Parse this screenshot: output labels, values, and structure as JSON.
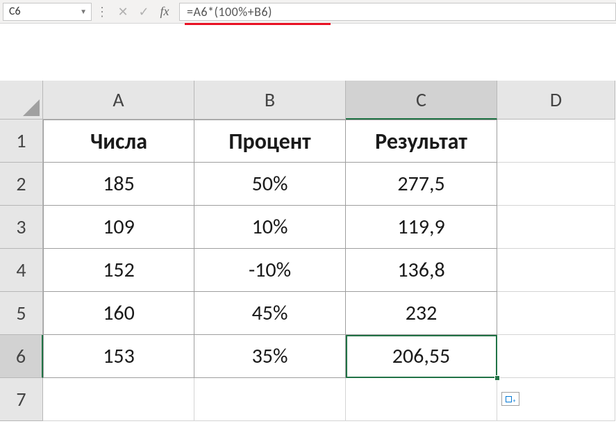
{
  "formula_bar": {
    "cell_ref": "C6",
    "formula": "=A6*(100%+B6)"
  },
  "columns": [
    "A",
    "B",
    "C",
    "D"
  ],
  "rows": [
    "1",
    "2",
    "3",
    "4",
    "5",
    "6",
    "7"
  ],
  "headers": {
    "A": "Числа",
    "B": "Процент",
    "C": "Результат"
  },
  "data": {
    "r2": {
      "A": "185",
      "B": "50%",
      "C": "277,5"
    },
    "r3": {
      "A": "109",
      "B": "10%",
      "C": "119,9"
    },
    "r4": {
      "A": "152",
      "B": "-10%",
      "C": "136,8"
    },
    "r5": {
      "A": "160",
      "B": "45%",
      "C": "232"
    },
    "r6": {
      "A": "153",
      "B": "35%",
      "C": "206,55"
    }
  },
  "active_cell": "C6",
  "chart_data": {
    "type": "table",
    "columns": [
      "Числа",
      "Процент",
      "Результат"
    ],
    "rows": [
      [
        185,
        "50%",
        "277,5"
      ],
      [
        109,
        "10%",
        "119,9"
      ],
      [
        152,
        "-10%",
        "136,8"
      ],
      [
        160,
        "45%",
        "232"
      ],
      [
        153,
        "35%",
        "206,55"
      ]
    ]
  }
}
